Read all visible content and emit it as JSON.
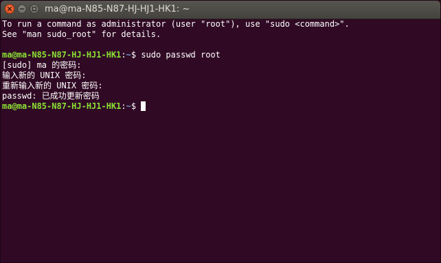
{
  "window": {
    "title": "ma@ma-N85-N87-HJ-HJ1-HK1: ~",
    "buttons": {
      "close": "close-icon",
      "minimize": "minimize-icon",
      "maximize": "maximize-icon"
    }
  },
  "colors": {
    "background": "#300a24",
    "titlebar": "#4f4d48",
    "prompt_user": "#8ae234",
    "prompt_path": "#729fcf",
    "text": "#ffffff",
    "close_button": "#df4b16"
  },
  "terminal": {
    "intro": [
      "To run a command as administrator (user \"root\"), use \"sudo <command>\".",
      "See \"man sudo_root\" for details."
    ],
    "prompt_user": "ma@ma-N85-N87-HJ-HJ1-HK1",
    "prompt_colon": ":",
    "prompt_path": "~",
    "prompt_symbol": "$ ",
    "command": "sudo passwd root",
    "output": [
      "[sudo] ma 的密码:",
      "输入新的 UNIX 密码:",
      "重新输入新的 UNIX 密码:",
      "passwd: 已成功更新密码"
    ]
  }
}
